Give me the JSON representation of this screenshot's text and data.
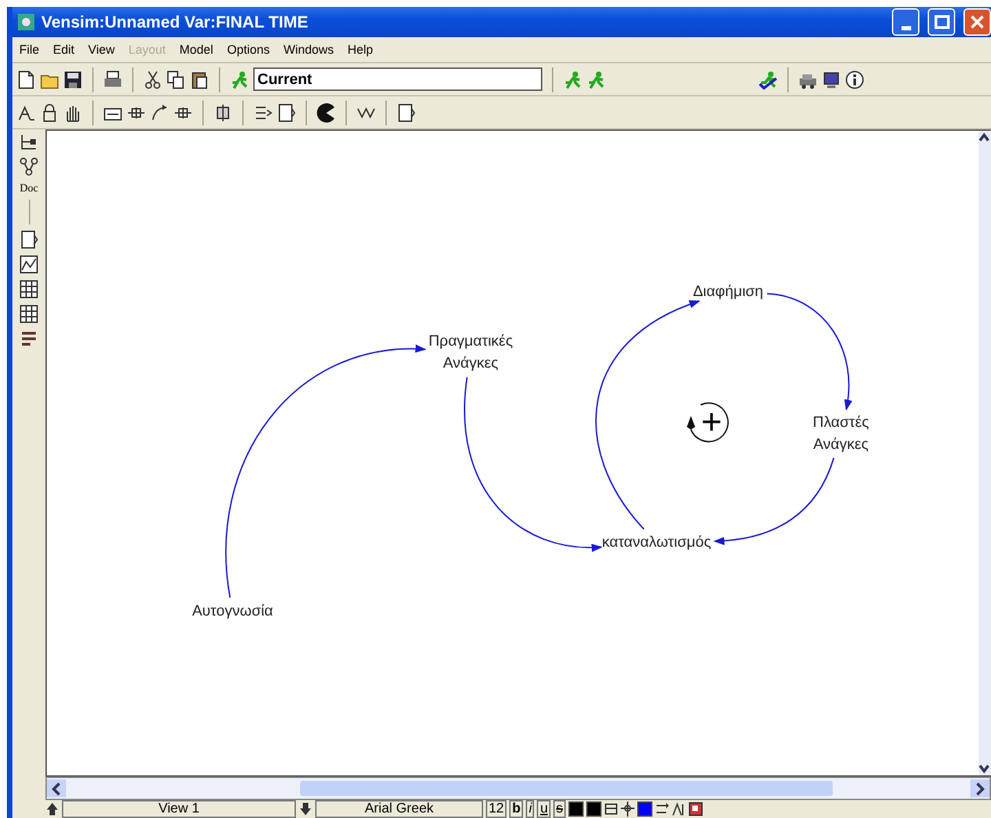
{
  "window": {
    "title": "Vensim:Unnamed Var:FINAL TIME"
  },
  "menu": [
    {
      "label": "File",
      "disabled": false
    },
    {
      "label": "Edit",
      "disabled": false
    },
    {
      "label": "View",
      "disabled": false
    },
    {
      "label": "Layout",
      "disabled": true
    },
    {
      "label": "Model",
      "disabled": false
    },
    {
      "label": "Options",
      "disabled": false
    },
    {
      "label": "Windows",
      "disabled": false
    },
    {
      "label": "Help",
      "disabled": false
    }
  ],
  "toolbar": {
    "run_name": "Current"
  },
  "sidebar": {
    "doc_label": "Doc"
  },
  "diagram": {
    "variables": [
      {
        "label": "Αυτογνωσία"
      },
      {
        "label": "Πραγματικές\nΑνάγκες"
      },
      {
        "label": "Διαφήμιση"
      },
      {
        "label": "Πλαστές\nΑνάγκες"
      },
      {
        "label": "καταναλωτισμός"
      }
    ],
    "loops": [
      {
        "sign": "+"
      }
    ]
  },
  "status_bar": {
    "view": "View 1",
    "font": "Arial Greek",
    "size": "12",
    "styles": [
      "b",
      "i",
      "u",
      "s"
    ],
    "swatches": [
      {
        "color": "#000000"
      },
      {
        "color": "#000000"
      },
      {
        "color": "#0000ff"
      }
    ]
  }
}
